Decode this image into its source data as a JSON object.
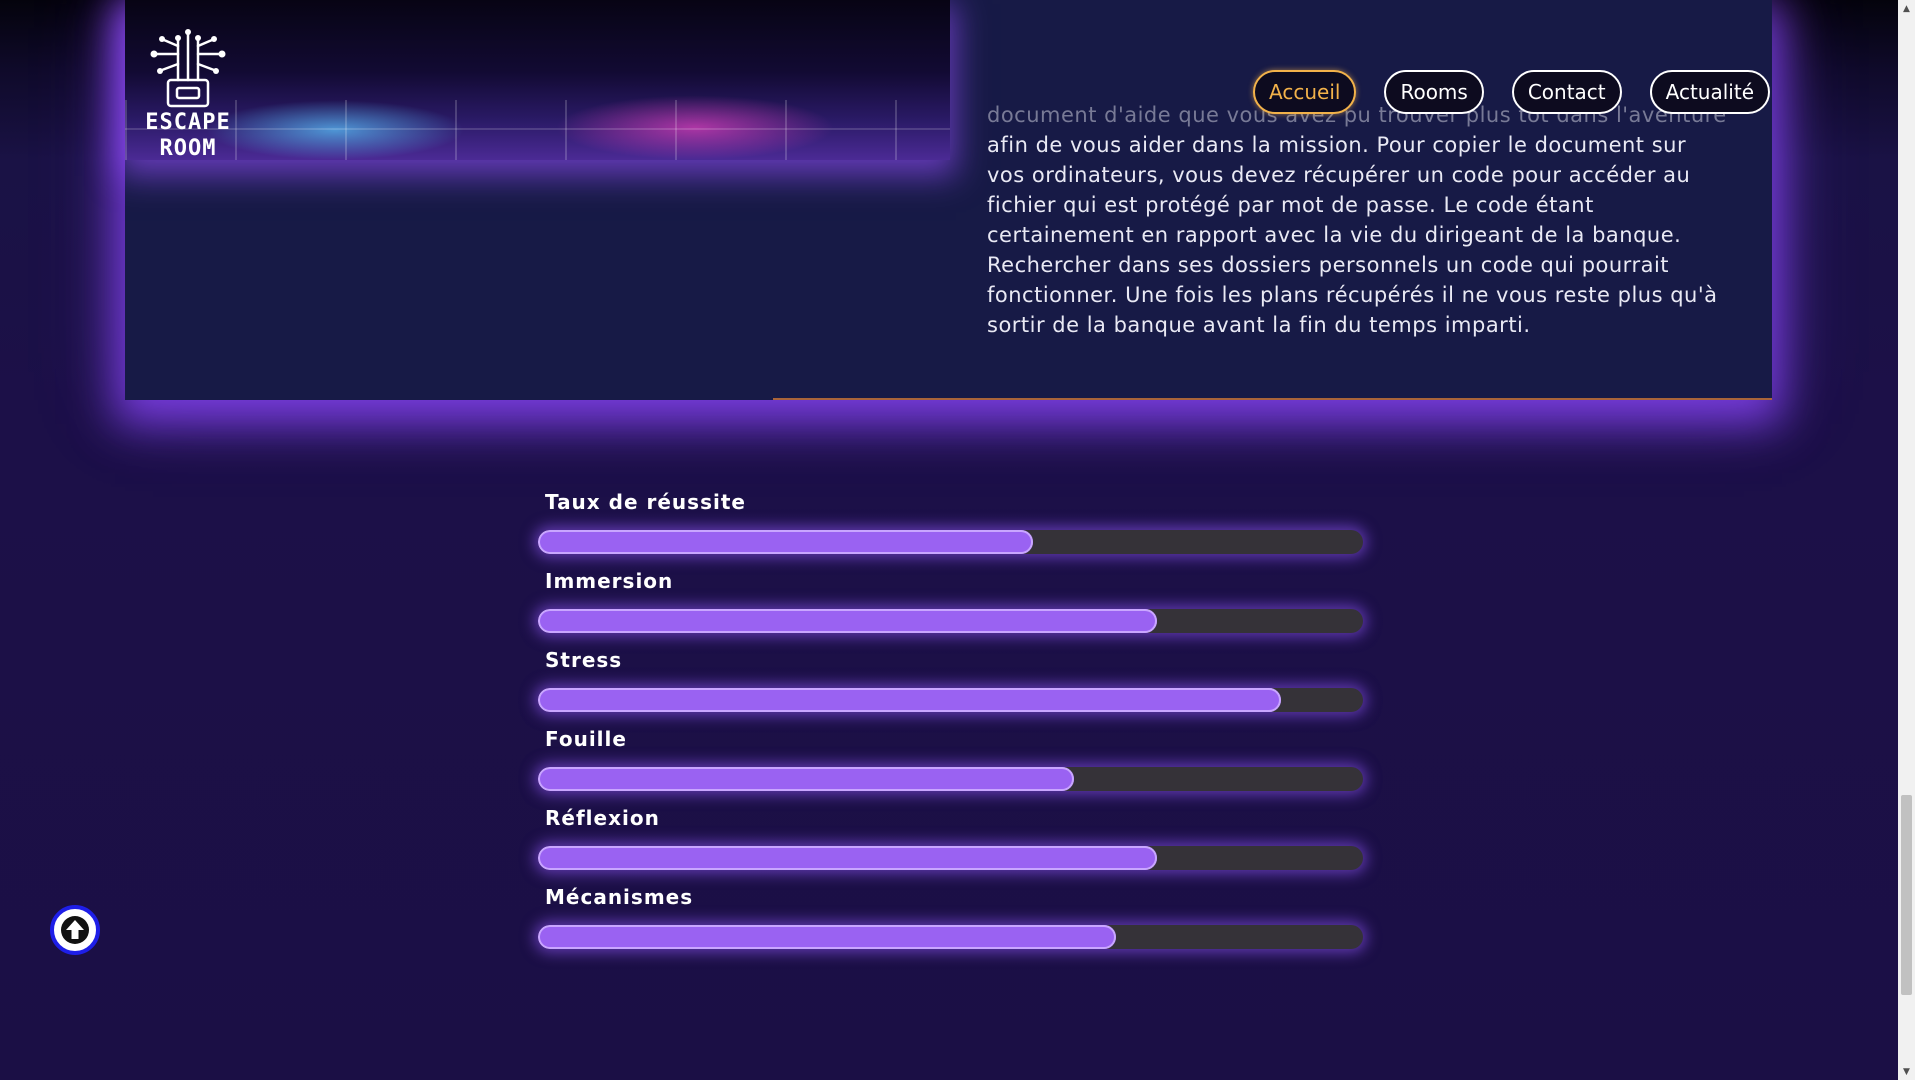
{
  "brand": {
    "logo_text_line1": "ESCAPE",
    "logo_text_line2": "ROOM",
    "logo_icon": "circuit-chip-icon"
  },
  "nav": {
    "items": [
      {
        "label": "Accueil",
        "active": true
      },
      {
        "label": "Rooms",
        "active": false
      },
      {
        "label": "Contact",
        "active": false
      },
      {
        "label": "Actualité",
        "active": false
      }
    ]
  },
  "room": {
    "description_lines": [
      "document d'aide que vous avez pu trouver plus tôt dans l'aventure",
      "afin de vous aider dans la mission. Pour copier le document sur",
      "vos ordinateurs, vous devez récupérer un code pour accéder au",
      "fichier qui est protégé par mot de passe. Le code étant",
      "certainement en rapport avec la vie du dirigeant de la banque.",
      "Rechercher dans ses dossiers personnels un code qui pourrait",
      "fonctionner. Une fois les plans récupérés il ne vous reste plus qu'à",
      "sortir de la banque avant la fin du temps imparti."
    ]
  },
  "stats": [
    {
      "label": "Taux de réussite",
      "percent": 60
    },
    {
      "label": "Immersion",
      "percent": 75
    },
    {
      "label": "Stress",
      "percent": 90
    },
    {
      "label": "Fouille",
      "percent": 65
    },
    {
      "label": "Réflexion",
      "percent": 75
    },
    {
      "label": "Mécanismes",
      "percent": 70
    }
  ],
  "back_to_top": {
    "icon": "arrow-up-circle-icon"
  },
  "colors": {
    "accent_active": "#f2b24a",
    "bar_fill": "#9a62f2",
    "bar_track": "#353238",
    "back_top_ring": "#1e1ee8"
  }
}
